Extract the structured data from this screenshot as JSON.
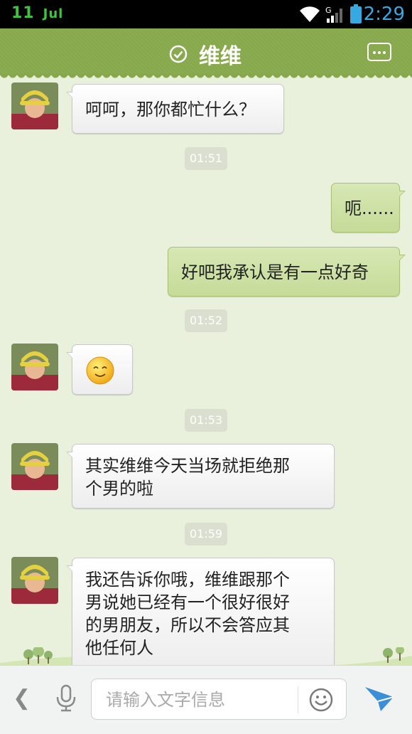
{
  "status_bar": {
    "day": "11",
    "month": "Jul",
    "time": "2:29",
    "network_type": "G"
  },
  "header": {
    "title": "维维",
    "verified_icon": "check-circle-icon",
    "menu_icon": "more-icon"
  },
  "messages": [
    {
      "id": "m1",
      "direction": "in",
      "lines": [
        "呵呵，那你都忙什么？"
      ]
    },
    {
      "id": "t1",
      "type": "timestamp",
      "text": "01:51"
    },
    {
      "id": "m2",
      "direction": "out",
      "lines": [
        "呃......"
      ]
    },
    {
      "id": "m3",
      "direction": "out",
      "lines": [
        "好吧我承认是有一点好奇"
      ]
    },
    {
      "id": "t2",
      "type": "timestamp",
      "text": "01:52"
    },
    {
      "id": "m4",
      "direction": "in",
      "emoji": "smiley-emoji"
    },
    {
      "id": "t3",
      "type": "timestamp",
      "text": "01:53"
    },
    {
      "id": "m5",
      "direction": "in",
      "lines": [
        "其实维维今天当场就拒绝那",
        "个男的啦"
      ]
    },
    {
      "id": "t4",
      "type": "timestamp",
      "text": "01:59"
    },
    {
      "id": "m6",
      "direction": "in",
      "lines": [
        "我还告诉你哦，维维跟那个",
        "男说她已经有一个很好很好",
        "的男朋友，所以不会答应其",
        "他任何人"
      ]
    }
  ],
  "input_bar": {
    "back_icon": "chevron-left-icon",
    "placeholder": "请输入文字信息",
    "voice_icon": "microphone-icon",
    "emoji_icon": "smiley-icon",
    "send_icon": "send-icon"
  },
  "colors": {
    "title_bar": "#86a84a",
    "chat_bg": "#e9f1dc",
    "out_bubble": "#cfe2a8",
    "in_bubble": "#ffffff",
    "time_accent": "#36a9e1"
  }
}
